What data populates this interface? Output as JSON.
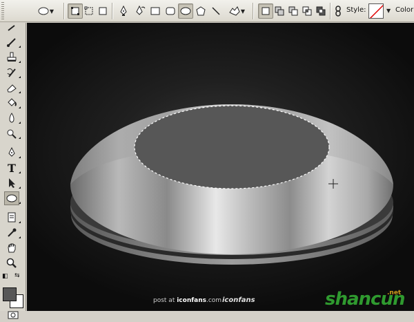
{
  "options_bar": {
    "style_label": "Style:",
    "color_label": "Color"
  },
  "canvas": {
    "watermark_post_prefix": "post at",
    "watermark_post_site": "iconfans",
    "watermark_post_suffix": ".com",
    "watermark_logo": "iconfans",
    "site_watermark": "shancun",
    "site_watermark_suffix": ".net"
  },
  "colors": {
    "foreground": "#575757",
    "background": "#ffffff",
    "canvas_dark": "#0c0c0c"
  }
}
